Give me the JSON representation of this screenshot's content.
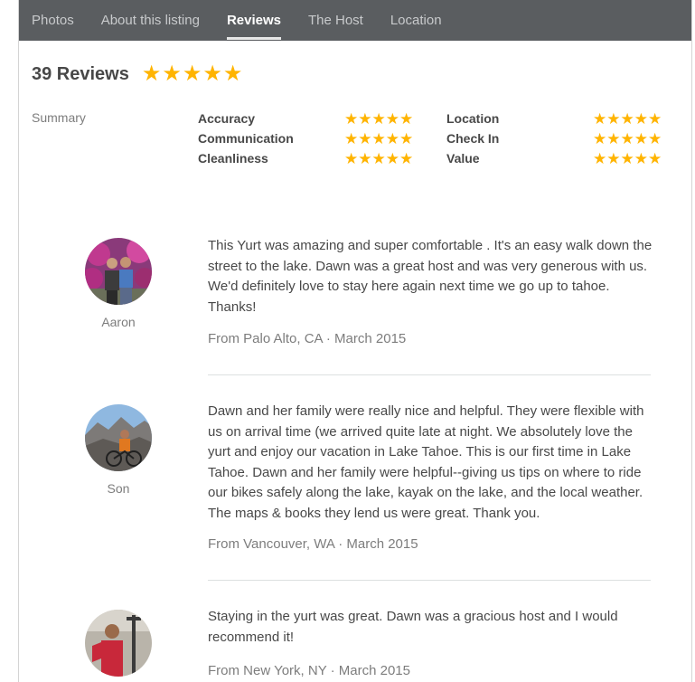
{
  "tabs": [
    {
      "label": "Photos"
    },
    {
      "label": "About this listing"
    },
    {
      "label": "Reviews"
    },
    {
      "label": "The Host"
    },
    {
      "label": "Location"
    }
  ],
  "reviews_header": {
    "title": "39 Reviews",
    "overall_stars": "★★★★★",
    "overall_rating": 5
  },
  "summary": {
    "label": "Summary",
    "categories": [
      {
        "name": "Accuracy",
        "stars": "★★★★★",
        "rating": 5
      },
      {
        "name": "Communication",
        "stars": "★★★★★",
        "rating": 5
      },
      {
        "name": "Cleanliness",
        "stars": "★★★★★",
        "rating": 5
      },
      {
        "name": "Location",
        "stars": "★★★★★",
        "rating": 5
      },
      {
        "name": "Check In",
        "stars": "★★★★★",
        "rating": 5
      },
      {
        "name": "Value",
        "stars": "★★★★★",
        "rating": 5
      }
    ]
  },
  "reviews": [
    {
      "name": "Aaron",
      "text": "This Yurt was amazing and super comfortable . It's an easy walk down the street to the lake. Dawn was a great host and was very generous with us. We'd definitely love to stay here again next time we go up to tahoe. Thanks!",
      "meta": "From Palo Alto, CA · March 2015"
    },
    {
      "name": "Son",
      "text": "Dawn and her family were really nice and helpful. They were flexible with us on arrival time (we arrived quite late at night. We absolutely love the yurt and enjoy our vacation in Lake Tahoe. This is our first time in Lake Tahoe. Dawn and her family were helpful--giving us tips on where to ride our bikes safely along the lake, kayak on the lake, and the local weather. The maps & books they lend us were great. Thank you.",
      "meta": "From Vancouver, WA · March 2015"
    },
    {
      "name": "",
      "text": "Staying in the yurt was great. Dawn was a gracious host and I would recommend it!",
      "meta": "From New York, NY · March 2015"
    }
  ],
  "colors": {
    "tabbar": "#5a5d60",
    "star": "#ffb400",
    "text": "#484848",
    "muted": "#7d7d7d"
  }
}
